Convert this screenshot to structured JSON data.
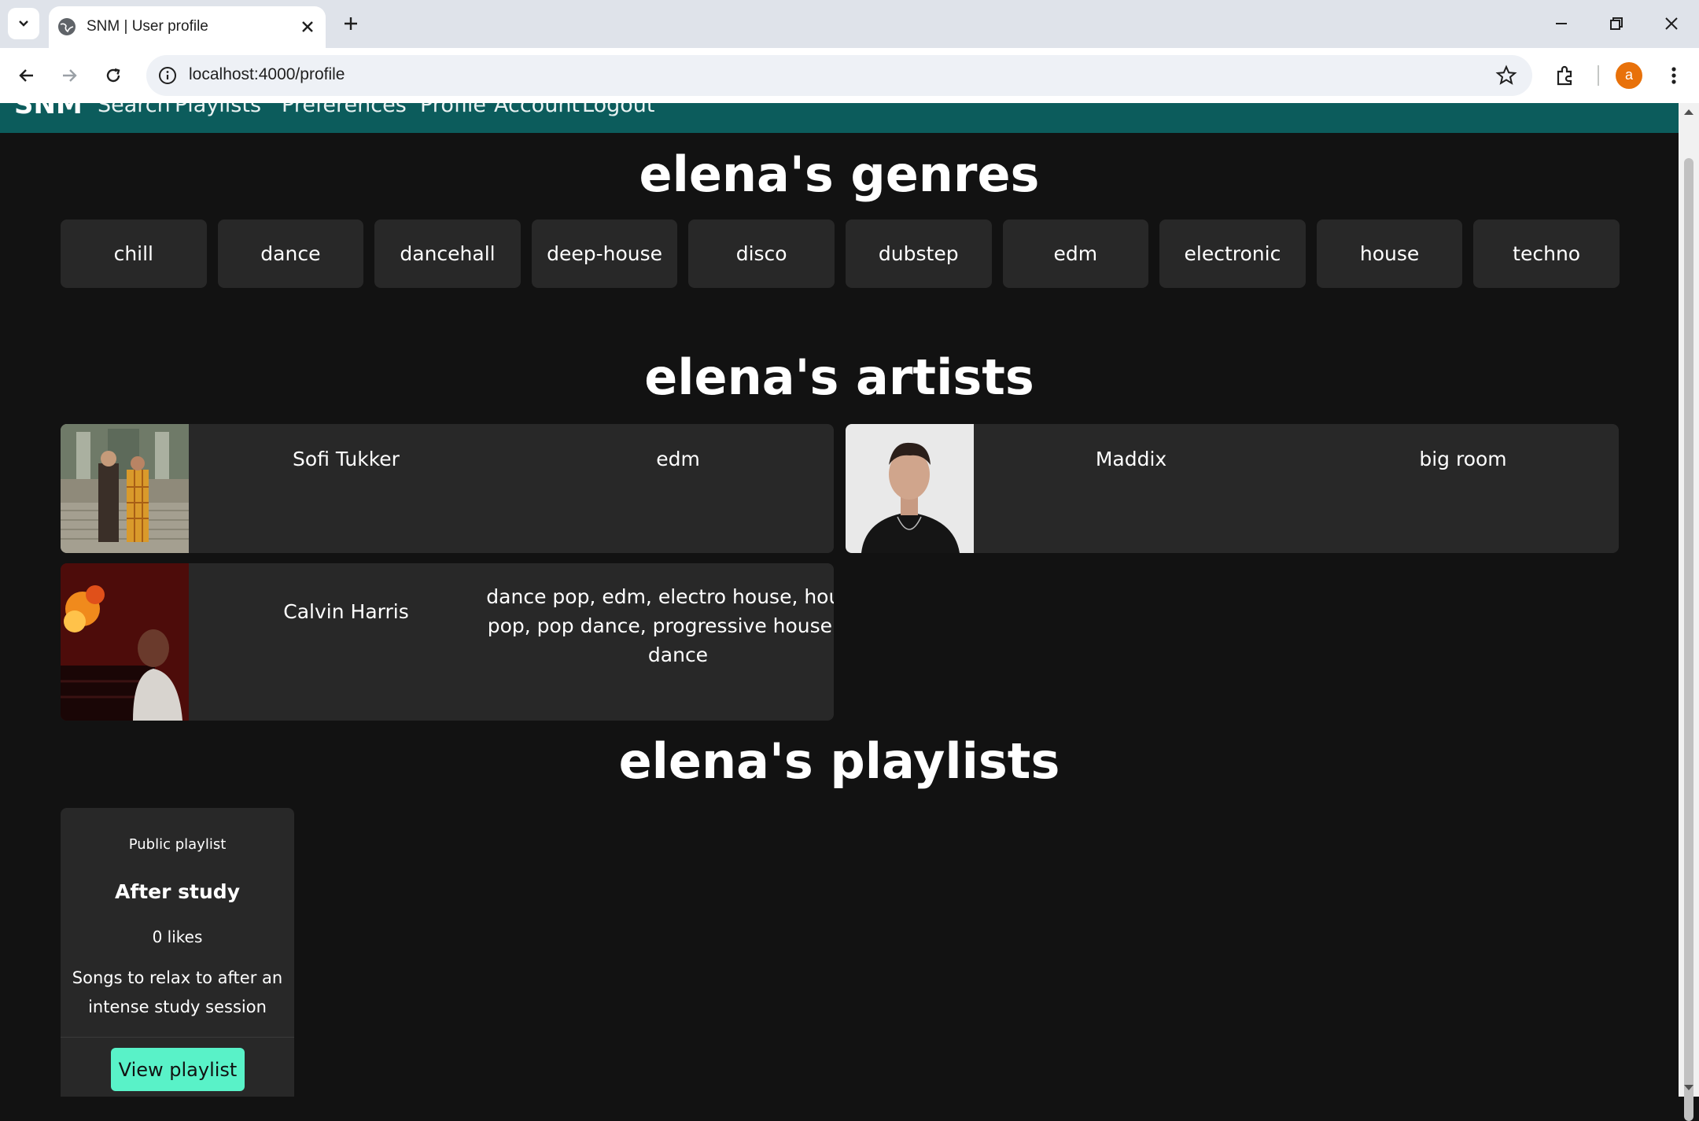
{
  "browser": {
    "tab_title": "SNM | User profile",
    "url": "localhost:4000/profile",
    "profile_initial": "a"
  },
  "site_nav": {
    "brand": "SNM",
    "links": [
      "Search",
      "Playlists",
      "Preferences",
      "Profile",
      "Account",
      "Logout"
    ]
  },
  "genres": {
    "title": "elena's genres",
    "items": [
      "chill",
      "dance",
      "dancehall",
      "deep-house",
      "disco",
      "dubstep",
      "edm",
      "electronic",
      "house",
      "techno"
    ]
  },
  "artists": {
    "title": "elena's artists",
    "items": [
      {
        "name": "Sofi Tukker",
        "genres": "edm"
      },
      {
        "name": "Maddix",
        "genres": "big room"
      },
      {
        "name": "Calvin Harris",
        "genres": "dance pop, edm, electro house, house, pop, pop dance, progressive house, uk dance"
      }
    ]
  },
  "playlists": {
    "title": "elena's playlists",
    "items": [
      {
        "visibility": "Public playlist",
        "name": "After study",
        "likes": "0 likes",
        "description": "Songs to relax to after an intense study session",
        "button_label": "View playlist"
      }
    ]
  },
  "colors": {
    "navbar": "#0c5c5c",
    "page_background": "#121212",
    "card": "#282828",
    "accent_button": "#59f2c8"
  }
}
